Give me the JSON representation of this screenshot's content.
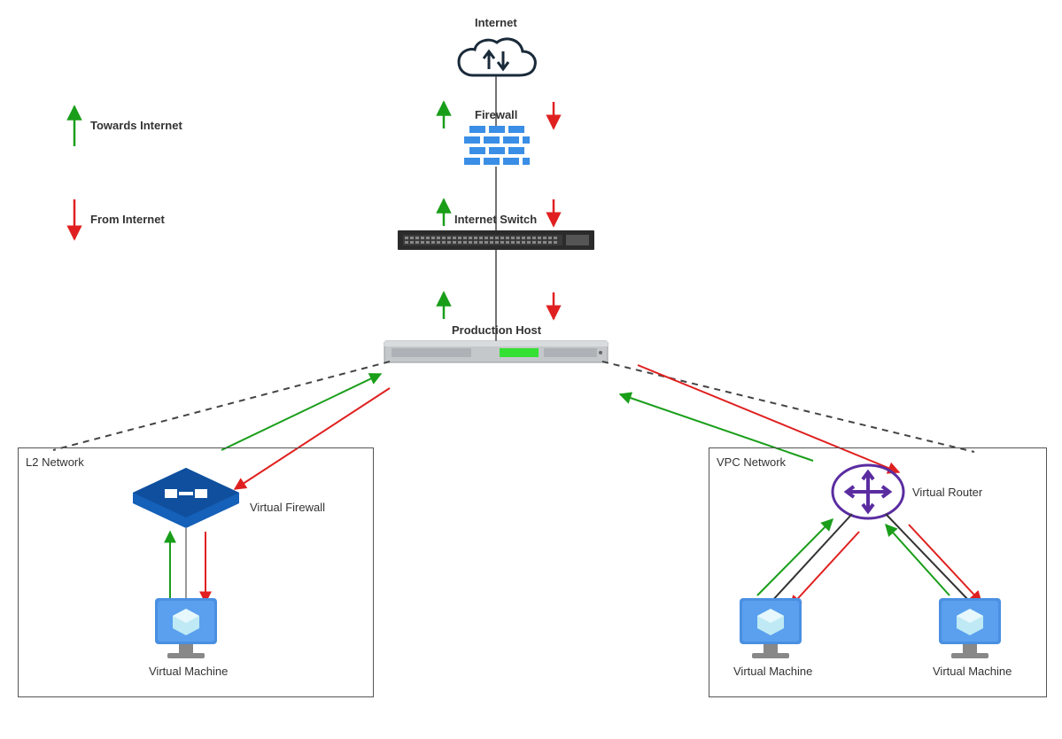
{
  "legend": {
    "towards": "Towards Internet",
    "from": "From Internet"
  },
  "nodes": {
    "internet": "Internet",
    "firewall": "Firewall",
    "internet_switch": "Internet Switch",
    "production_host": "Production Host",
    "virtual_firewall": "Virtual Firewall",
    "virtual_router": "Virtual Router",
    "virtual_machine": "Virtual Machine"
  },
  "boxes": {
    "l2": "L2 Network",
    "vpc": "VPC Network"
  },
  "colors": {
    "green": "#1a9e1a",
    "red": "#e02020",
    "blue": "#1e72c8",
    "darkblue": "#0f3d70",
    "purple": "#5a2ca0",
    "gray": "#555555",
    "lightblue": "#4a90e2",
    "cyan": "#8edff0",
    "serverGray": "#b8bcbf",
    "switchDark": "#2b2b2b",
    "ledGreen": "#33e033"
  }
}
